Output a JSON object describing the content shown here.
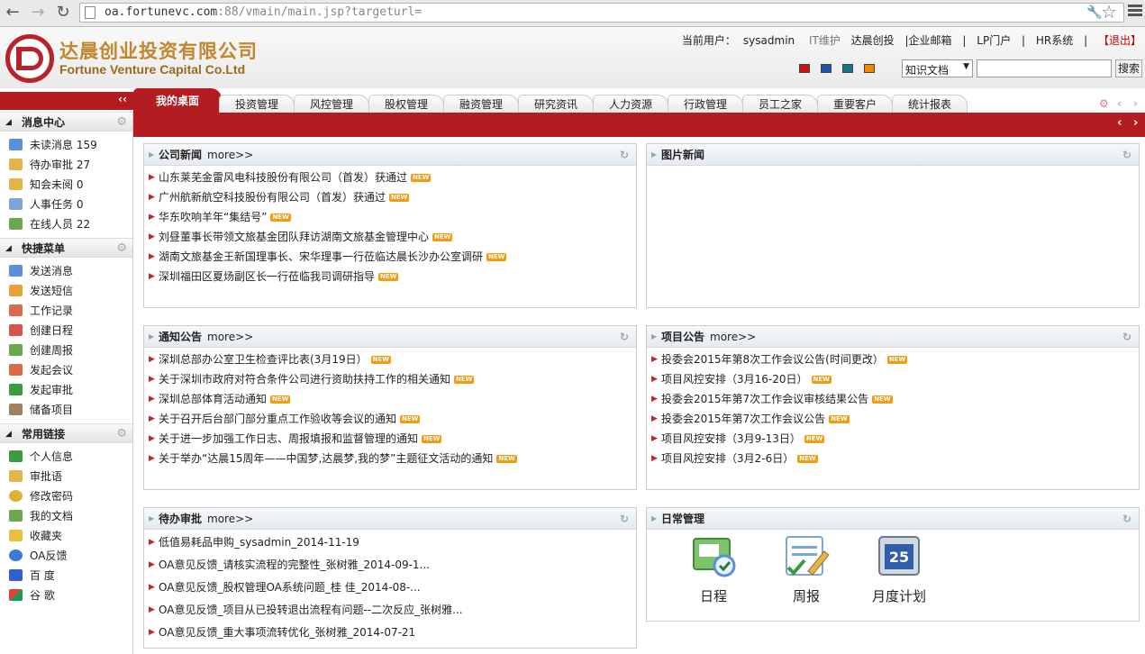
{
  "browser": {
    "url_host": "oa.fortunevc.com",
    "url_rest": ":88/vmain/main.jsp?targeturl="
  },
  "header": {
    "logo_cn": "达晨创业投资有限公司",
    "logo_en": "Fortune Venture Capital Co.Ltd",
    "current_user_label": "当前用户：",
    "current_user": "sysadmin",
    "links": [
      "IT维护",
      "达晨创投",
      "|企业邮箱",
      "|",
      "LP门户",
      "|",
      "HR系统",
      "|",
      "【退出】"
    ],
    "color_swatches": [
      "#cc1111",
      "#2255aa",
      "#117788",
      "#ee8800"
    ],
    "search_select": "知识文档",
    "search_button": "搜索",
    "search_value": ""
  },
  "tabs": {
    "active": "我的桌面",
    "items": [
      "投资管理",
      "风控管理",
      "股权管理",
      "融资管理",
      "研究资讯",
      "人力资源",
      "行政管理",
      "员工之家",
      "重要客户",
      "统计报表"
    ]
  },
  "sidebar": {
    "collapse": "‹‹",
    "sections": [
      {
        "title": "消息中心",
        "items": [
          {
            "label": "未读消息 159",
            "icon": "envelope-icon"
          },
          {
            "label": "待办审批 27",
            "icon": "approve-icon"
          },
          {
            "label": "知会未阅 0",
            "icon": "notice-icon"
          },
          {
            "label": "人事任务 0",
            "icon": "person-card-icon"
          },
          {
            "label": "在线人员 22",
            "icon": "user-online-icon"
          }
        ]
      },
      {
        "title": "快捷菜单",
        "items": [
          {
            "label": "发送消息",
            "icon": "envelope-icon"
          },
          {
            "label": "发送短信",
            "icon": "sms-icon"
          },
          {
            "label": "工作记录",
            "icon": "record-icon"
          },
          {
            "label": "创建日程",
            "icon": "calendar-icon"
          },
          {
            "label": "创建周报",
            "icon": "report-user-icon"
          },
          {
            "label": "发起会议",
            "icon": "meeting-icon"
          },
          {
            "label": "发起审批",
            "icon": "approval-arrow-icon"
          },
          {
            "label": "储备项目",
            "icon": "project-icon"
          }
        ]
      },
      {
        "title": "常用链接",
        "items": [
          {
            "label": "个人信息",
            "icon": "person-info-icon"
          },
          {
            "label": "审批语",
            "icon": "edit-icon"
          },
          {
            "label": "修改密码",
            "icon": "lock-icon"
          },
          {
            "label": "我的文档",
            "icon": "document-icon"
          },
          {
            "label": "收藏夹",
            "icon": "favorites-icon"
          },
          {
            "label": "OA反馈",
            "icon": "ie-icon"
          },
          {
            "label": "百 度",
            "icon": "baidu-icon"
          },
          {
            "label": "谷 歌",
            "icon": "google-icon"
          }
        ]
      }
    ]
  },
  "panels": {
    "company_news": {
      "title": "公司新闻",
      "more": "more>>",
      "items": [
        "山东莱芜金雷风电科技股份有限公司（首发）获通过",
        "广州航新航空科技股份有限公司（首发）获通过",
        "华东吹响羊年“集结号”",
        "刘昼董事长带领文旅基金团队拜访湖南文旅基金管理中心",
        "湖南文旅基金王新国理事长、宋华理事一行莅临达晨长沙办公室调研",
        "深圳福田区夏炀副区长一行莅临我司调研指导"
      ]
    },
    "photo_news": {
      "title": "图片新闻"
    },
    "notices": {
      "title": "通知公告",
      "more": "more>>",
      "items": [
        "深圳总部办公室卫生检查评比表(3月19日）",
        "关于深圳市政府对符合条件公司进行资助扶持工作的相关通知",
        "深圳总部体育活动通知",
        "关于召开后台部门部分重点工作验收等会议的通知",
        "关于进一步加强工作日志、周报填报和监督管理的通知",
        "关于举办“达晨15周年——中国梦,达晨梦,我的梦”主题征文活动的通知"
      ]
    },
    "project_notices": {
      "title": "项目公告",
      "more": "more>>",
      "items": [
        "投委会2015年第8次工作会议公告(时间更改）",
        "项目风控安排（3月16-20日）",
        "投委会2015年第7次工作会议审核结果公告",
        "投委会2015年第7次工作会议公告",
        "项目风控安排（3月9-13日）",
        "项目风控安排（3月2-6日）"
      ]
    },
    "pending": {
      "title": "待办审批",
      "more": "more>>",
      "items": [
        "低值易耗品申购_sysadmin_2014-11-19",
        "OA意见反馈_请核实流程的完整性_张树雅_2014-09-1...",
        "OA意见反馈_股权管理OA系统问题_桂 佳_2014-08-...",
        "OA意见反馈_项目从已投转退出流程有问题--二次反应_张树雅...",
        "OA意见反馈_重大事项流转优化_张树雅_2014-07-21"
      ]
    },
    "daily": {
      "title": "日常管理",
      "items": [
        {
          "label": "日程",
          "icon": "calendar-check-icon"
        },
        {
          "label": "周报",
          "icon": "weekly-report-icon"
        },
        {
          "label": "月度计划",
          "icon": "monthly-plan-icon",
          "day": "25"
        }
      ]
    },
    "new_badge": "NEW"
  }
}
